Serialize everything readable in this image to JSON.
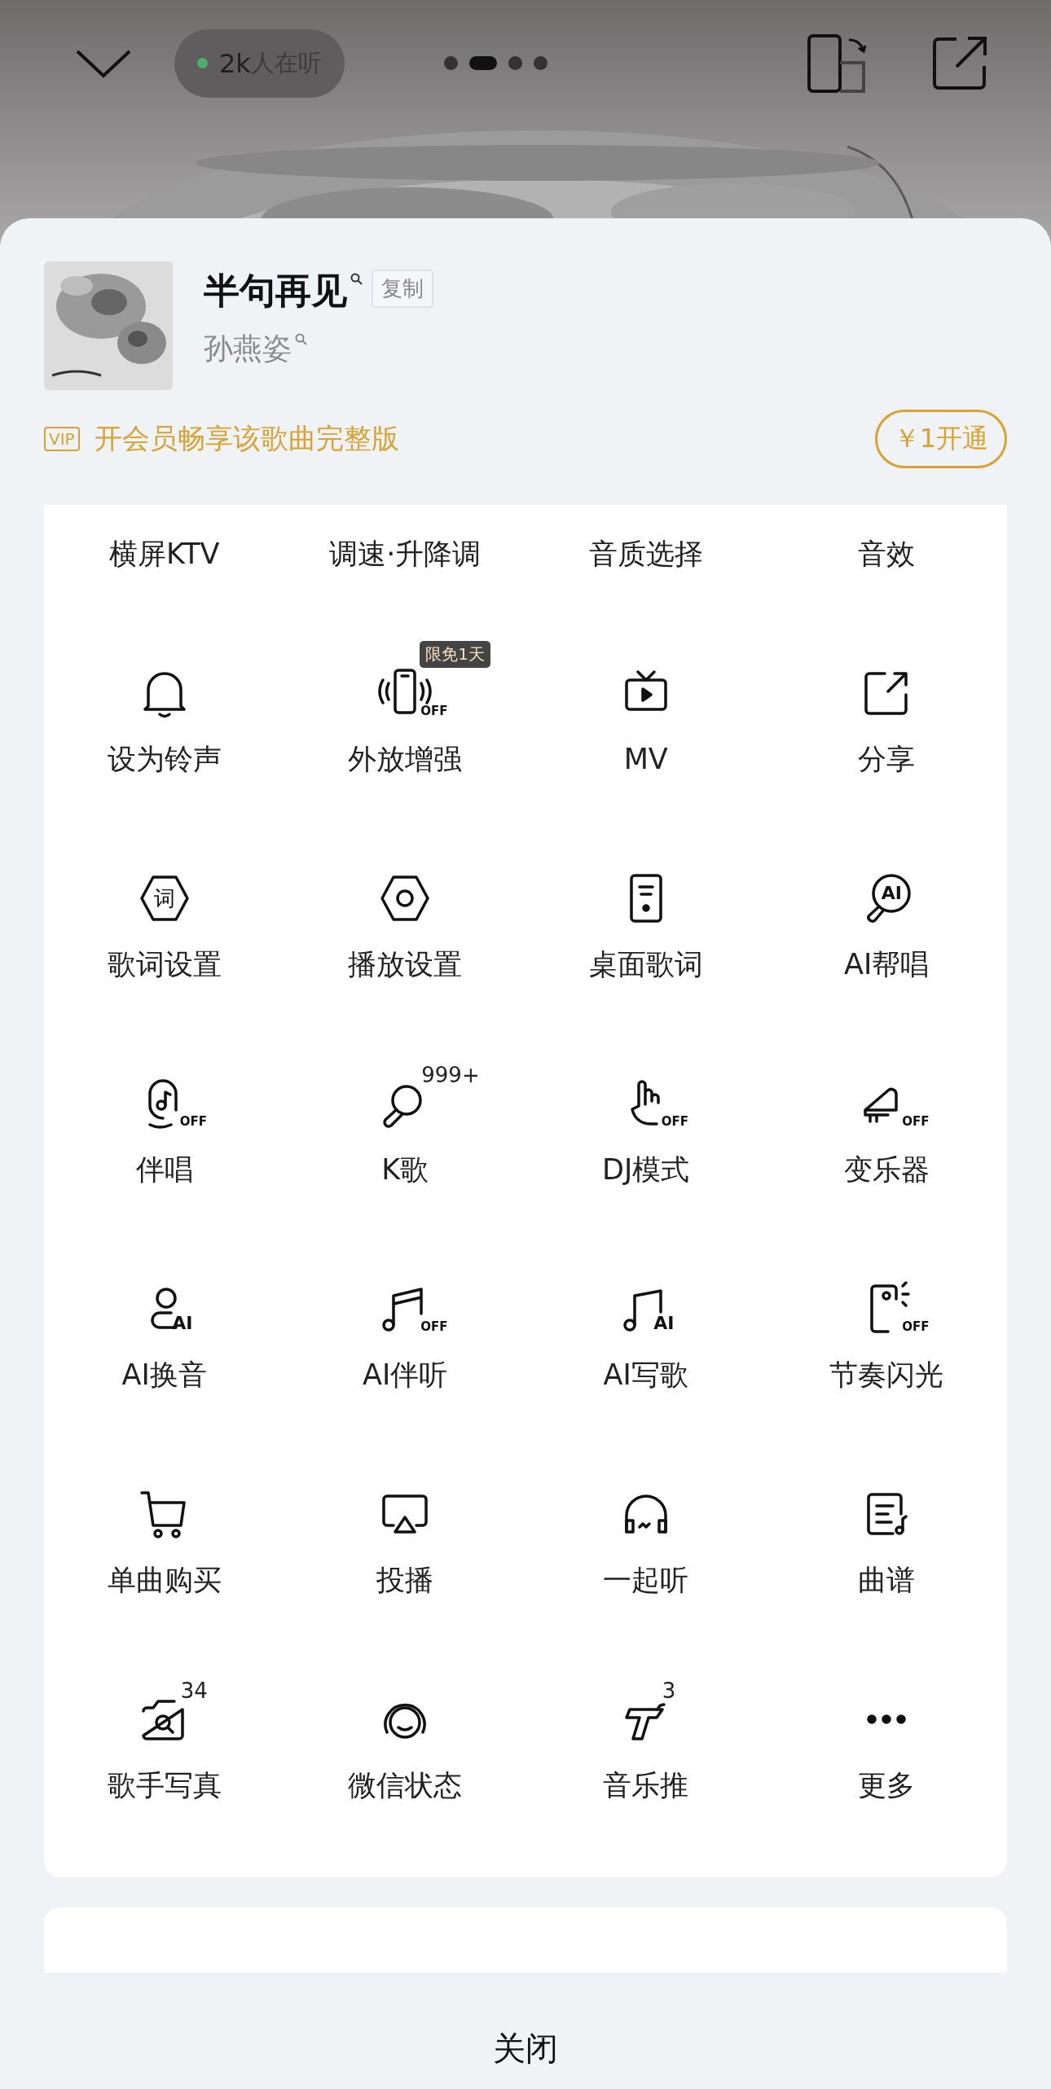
{
  "top_bar": {
    "listeners": {
      "count": "2k",
      "label": "人在听"
    },
    "page_dots": [
      {
        "selected": false
      },
      {
        "selected": true
      },
      {
        "selected": false
      },
      {
        "selected": false
      }
    ]
  },
  "song": {
    "title": "半句再见",
    "copy_label": "复制",
    "artist": "孙燕姿"
  },
  "vip_banner": {
    "badge": "VIP",
    "text": "开会员畅享该歌曲完整版",
    "button": "￥1开通"
  },
  "actions": [
    {
      "label": "横屏KTV"
    },
    {
      "label": "调速·升降调"
    },
    {
      "label": "音质选择"
    },
    {
      "label": "音效"
    },
    {
      "label": "设为铃声"
    },
    {
      "label": "外放增强",
      "status": "OFF",
      "badge": {
        "kind": "tag",
        "text": "限免1天"
      }
    },
    {
      "label": "MV"
    },
    {
      "label": "分享"
    },
    {
      "label": "歌词设置",
      "icon_text": "词"
    },
    {
      "label": "播放设置"
    },
    {
      "label": "桌面歌词"
    },
    {
      "label": "AI帮唱",
      "icon_text": "AI"
    },
    {
      "label": "伴唱",
      "status": "OFF"
    },
    {
      "label": "K歌",
      "badge": {
        "kind": "count",
        "text": "999+"
      }
    },
    {
      "label": "DJ模式",
      "status": "OFF"
    },
    {
      "label": "变乐器",
      "status": "OFF"
    },
    {
      "label": "AI换音",
      "icon_text": "AI"
    },
    {
      "label": "AI伴听",
      "status": "OFF"
    },
    {
      "label": "AI写歌",
      "icon_text": "AI"
    },
    {
      "label": "节奏闪光",
      "status": "OFF"
    },
    {
      "label": "单曲购买"
    },
    {
      "label": "投播"
    },
    {
      "label": "一起听"
    },
    {
      "label": "曲谱"
    },
    {
      "label": "歌手写真",
      "badge": {
        "kind": "count",
        "text": "34"
      }
    },
    {
      "label": "微信状态"
    },
    {
      "label": "音乐推",
      "badge": {
        "kind": "count",
        "text": "3"
      }
    },
    {
      "label": "更多"
    }
  ],
  "close_button": "关闭"
}
